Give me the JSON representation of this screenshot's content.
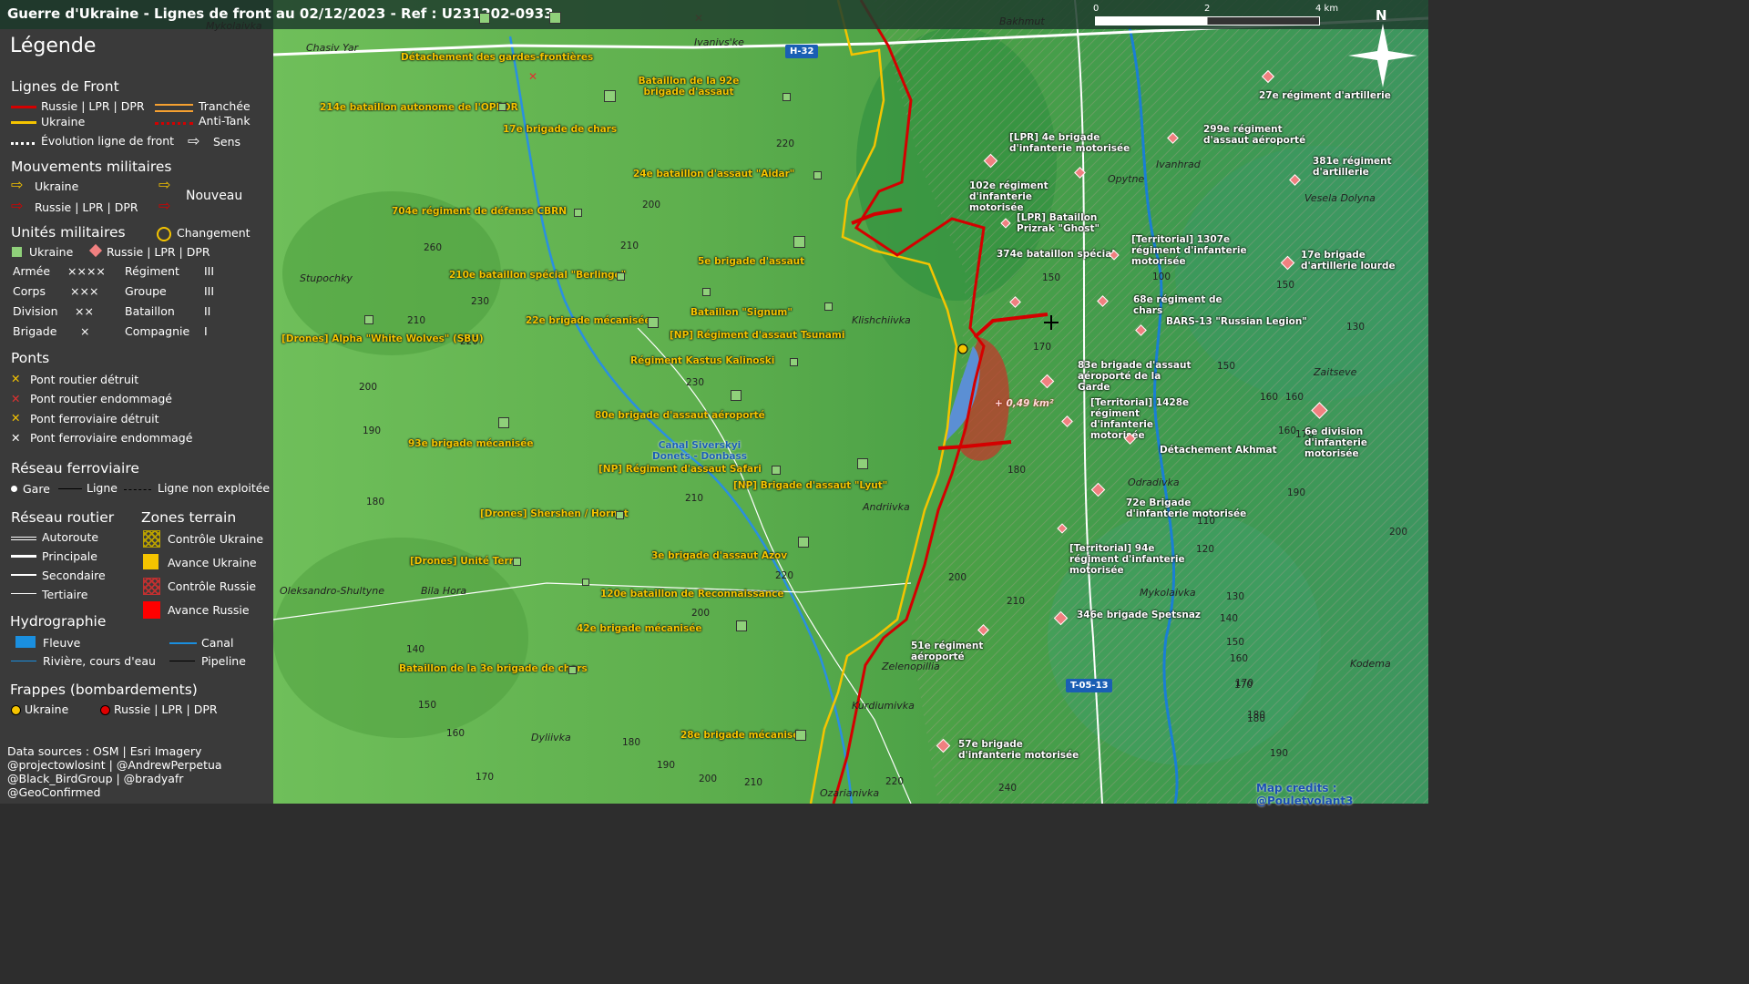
{
  "title": "Guerre d'Ukraine - Lignes de front au 02/12/2023 - Ref : U231202-0933",
  "colors": {
    "russia": "#d40000",
    "ukraine": "#f5c400",
    "ukraine_unit": "#8fd07a",
    "russia_unit": "#f08080",
    "canal": "#1a8fdf"
  },
  "legend": {
    "title": "Légende",
    "front": {
      "heading": "Lignes de Front",
      "russia": "Russie | LPR | DPR",
      "ukraine": "Ukraine",
      "trench": "Tranchée",
      "antitank": "Anti-Tank",
      "evolution": "Évolution ligne de front",
      "sens": "Sens"
    },
    "moves": {
      "heading": "Mouvements militaires",
      "ukraine": "Ukraine",
      "russia": "Russie | LPR | DPR",
      "new": "Nouveau"
    },
    "units": {
      "heading": "Unités militaires",
      "change": "Changement",
      "ukraine": "Ukraine",
      "russia": "Russie | LPR | DPR",
      "echelons": [
        {
          "l": "Armée",
          "s": "××××",
          "l2": "Régiment",
          "s2": "III"
        },
        {
          "l": "Corps",
          "s": "×××",
          "l2": "Groupe",
          "s2": "III"
        },
        {
          "l": "Division",
          "s": "××",
          "l2": "Bataillon",
          "s2": "II"
        },
        {
          "l": "Brigade",
          "s": "×",
          "l2": "Compagnie",
          "s2": "I"
        }
      ]
    },
    "bridges": {
      "heading": "Ponts",
      "items": [
        "Pont routier détruit",
        "Pont routier endommagé",
        "Pont ferroviaire détruit",
        "Pont ferroviaire endommagé"
      ]
    },
    "rail": {
      "heading": "Réseau ferroviaire",
      "gare": "Gare",
      "ligne": "Ligne",
      "non": "Ligne non exploitée"
    },
    "roads": {
      "heading": "Réseau routier",
      "items": [
        "Autoroute",
        "Principale",
        "Secondaire",
        "Tertiaire"
      ]
    },
    "zones": {
      "heading": "Zones terrain",
      "items": [
        "Contrôle Ukraine",
        "Avance Ukraine",
        "Contrôle Russie",
        "Avance Russie"
      ]
    },
    "hydro": {
      "heading": "Hydrographie",
      "fleuve": "Fleuve",
      "canal": "Canal",
      "riviere": "Rivière, cours d'eau",
      "pipeline": "Pipeline"
    },
    "strikes": {
      "heading": "Frappes (bombardements)",
      "ukraine": "Ukraine",
      "russia": "Russie | LPR | DPR"
    },
    "credits": [
      "Data sources : OSM | Esri Imagery",
      "@projectowlosint | @AndrewPerpetua",
      "@Black_BirdGroup | @bradyafr",
      "@GeoConfirmed"
    ]
  },
  "scale": {
    "labels": [
      "0",
      "2",
      "4 km"
    ]
  },
  "north": "N",
  "map_credit": "Map credits : @Pouletvolant3",
  "area_label": "+ 0,49 km²",
  "canal_label": "Canal Siverskyi\nDonets - Donbass",
  "roads": [
    "H-32",
    "T-05-13"
  ],
  "places": [
    "Mykolaivka",
    "Chasiv Yar",
    "Ivanivs'ke",
    "Bakhmut",
    "Stupochky",
    "Klishchiivka",
    "Opytne",
    "Ivanhrad",
    "Vesela Dolyna",
    "Zaitseve",
    "Odradivka",
    "Andriivka",
    "Oleksandro-Shultyne",
    "Bila Hora",
    "Zelenopillia",
    "Kurdiumivka",
    "Dyliivka",
    "Ozarianivka",
    "Kodema",
    "Mykolaivka"
  ],
  "elevations": [
    "220",
    "200",
    "210",
    "260",
    "230",
    "210",
    "220",
    "230",
    "200",
    "190",
    "210",
    "180",
    "220",
    "200",
    "140",
    "150",
    "160",
    "170",
    "180",
    "190",
    "200",
    "210",
    "220",
    "240",
    "200",
    "210",
    "150",
    "160",
    "170",
    "180",
    "190",
    "160",
    "150",
    "140",
    "120",
    "130",
    "110",
    "150",
    "160",
    "170",
    "180",
    "190",
    "200",
    "170",
    "100",
    "130",
    "150",
    "160",
    "170",
    "180"
  ],
  "ukraine_units": [
    "Détachement des gardes-frontières",
    "214e bataillon autonome de l'OPFOR",
    "Bataillon de la 92e brigade d'assaut",
    "17e brigade de chars",
    "24e bataillon d'assaut \"Aidar\"",
    "704e régiment de défense CBRN",
    "210e bataillon spécial \"Berlingo\"",
    "5e brigade d'assaut",
    "Bataillon \"Signum\"",
    "22e brigade mécanisée",
    "[Drones] Alpha \"White Wolves\" (SBU)",
    "[NP] Régiment d'assaut Tsunami",
    "Régiment Kastus Kalinoski",
    "80e brigade d'assaut aéroporté",
    "93e brigade mécanisée",
    "[NP] Régiment d'assaut Safari",
    "[NP] Brigade d'assaut \"Lyut\"",
    "[Drones] Shershen / Hornet",
    "[Drones] Unité Terra",
    "3e brigade d'assaut Azov",
    "120e bataillon de Reconnaissance",
    "42e brigade mécanisée",
    "Bataillon de la 3e brigade de chars",
    "28e brigade mécanisée"
  ],
  "russia_units": [
    "27e régiment d'artillerie",
    "[LPR] 4e brigade d'infanterie motorisée",
    "299e régiment d'assaut aéroporté",
    "102e régiment d'infanterie motorisée",
    "381e régiment d'artillerie",
    "[LPR] Bataillon Prizrak \"Ghost\"",
    "374e bataillon spécial",
    "[Territorial] 1307e régiment d'infanterie motorisée",
    "17e brigade d'artillerie lourde",
    "68e régiment de chars",
    "BARS-13 \"Russian Legion\"",
    "83e brigade d'assaut aéroporté de la Garde",
    "[Territorial] 1428e régiment d'infanterie motorisée",
    "6e division d'infanterie motorisée",
    "Détachement Akhmat",
    "72e Brigade d'infanterie motorisée",
    "[Territorial] 94e régiment d'infanterie motorisée",
    "346e brigade Spetsnaz",
    "51e régiment aéroporté",
    "57e brigade d'infanterie motorisée"
  ]
}
